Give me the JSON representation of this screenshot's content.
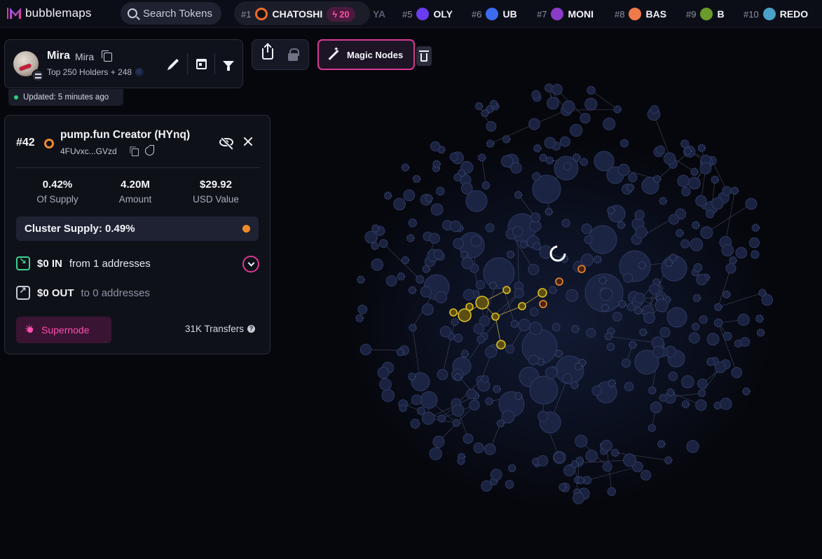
{
  "app": {
    "logo_text": "bubblemaps",
    "search_placeholder": "Search Tokens"
  },
  "ticker": {
    "items": [
      {
        "rank": "#1",
        "name": "CHATOSHI",
        "icon_color": "#f06b2a",
        "boost": "20"
      },
      {
        "rank": "",
        "name": "YA",
        "faded": true
      },
      {
        "rank": "#5",
        "name": "OLY",
        "icon_color": "#6a3cf0"
      },
      {
        "rank": "#6",
        "name": "UB",
        "icon_color": "#3b6cf0"
      },
      {
        "rank": "#7",
        "name": "MONI",
        "icon_color": "#8a3cc8"
      },
      {
        "rank": "#8",
        "name": "BAS",
        "icon_color": "#f07a4a"
      },
      {
        "rank": "#9",
        "name": "B",
        "icon_color": "#6a9a2a"
      },
      {
        "rank": "#10",
        "name": "REDO",
        "icon_color": "#4aa0c8"
      }
    ]
  },
  "project": {
    "name": "Mira",
    "symbol": "Mira",
    "subtitle": "Top 250 Holders + 248",
    "updated": "Updated: 5 minutes ago"
  },
  "toolbar": {
    "magic_label": "Magic Nodes"
  },
  "wallet": {
    "rank": "#42",
    "name": "pump.fun Creator (HYnq)",
    "address": "4FUvxc...GVzd",
    "stats": [
      {
        "value": "0.42%",
        "label": "Of Supply"
      },
      {
        "value": "4.20M",
        "label": "Amount"
      },
      {
        "value": "$29.92",
        "label": "USD Value"
      }
    ],
    "cluster_supply": "Cluster Supply: 0.49%",
    "in_amount": "$0 IN",
    "in_desc": "from 1 addresses",
    "out_amount": "$0 OUT",
    "out_desc": "to 0 addresses",
    "supernode_label": "Supernode",
    "transfers": "31K Transfers"
  },
  "colors": {
    "accent_pink": "#d63b93",
    "highlight_yellow": "#e0c020",
    "highlight_orange": "#f08a2c",
    "bubble_fill": "#1a2240"
  }
}
